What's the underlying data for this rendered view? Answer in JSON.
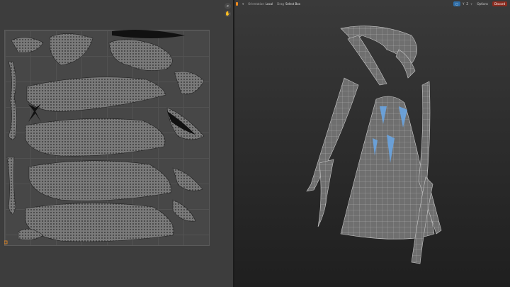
{
  "viewport_header": {
    "orientation_label": "Orientation",
    "orientation_value": "Local",
    "drag_label": "Drag",
    "drag_value": "Select Box",
    "options_label": "Options",
    "overlay_value": "Discord",
    "axis_labels": [
      "Y",
      "Z"
    ]
  },
  "colors": {
    "accent": "#2f6ea8",
    "select_orange": "#f08a1c",
    "mesh_grey": "#8f8f8f",
    "selected_blue": "#6aa8e8"
  },
  "icons": [
    "zoom-icon",
    "pan-icon",
    "move-icon",
    "drag-icon",
    "x-ray-icon",
    "axis-gizmo-icon"
  ]
}
